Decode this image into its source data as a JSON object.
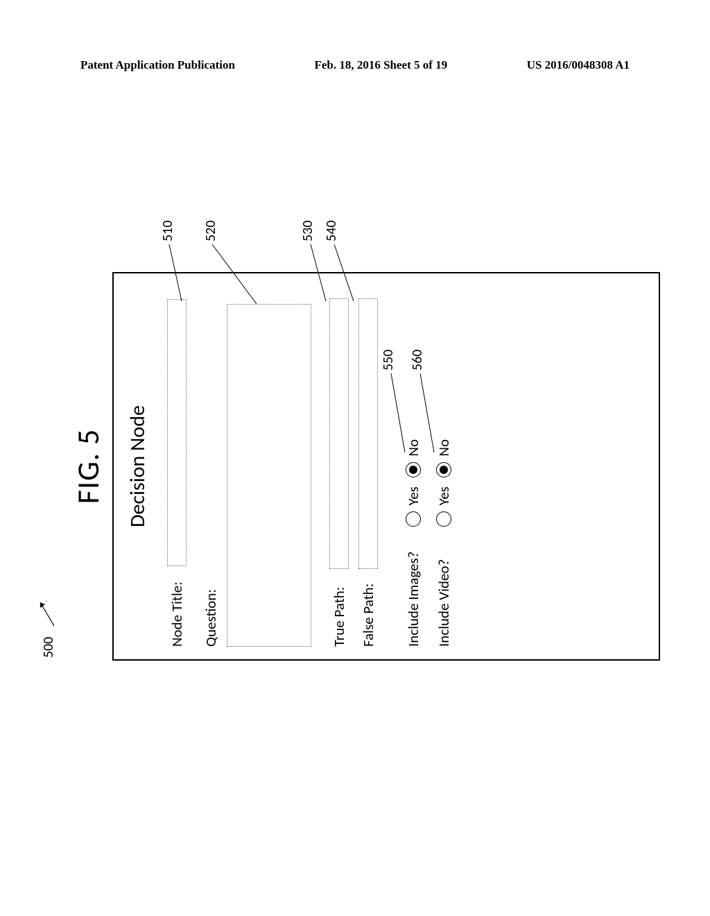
{
  "header": {
    "left": "Patent Application Publication",
    "center": "Feb. 18, 2016  Sheet 5 of 19",
    "right": "US 2016/0048308 A1"
  },
  "figure": {
    "title": "FIG. 5",
    "ref_main": "500",
    "panel_title": "Decision Node",
    "labels": {
      "node_title": "Node Title:",
      "question": "Question:",
      "true_path": "True Path:",
      "false_path": "False Path:",
      "include_images": "Include Images?",
      "include_video": "Include Video?"
    },
    "options": {
      "yes": "Yes",
      "no": "No"
    },
    "refs": {
      "r510": "510",
      "r520": "520",
      "r530": "530",
      "r540": "540",
      "r550": "550",
      "r560": "560"
    }
  }
}
